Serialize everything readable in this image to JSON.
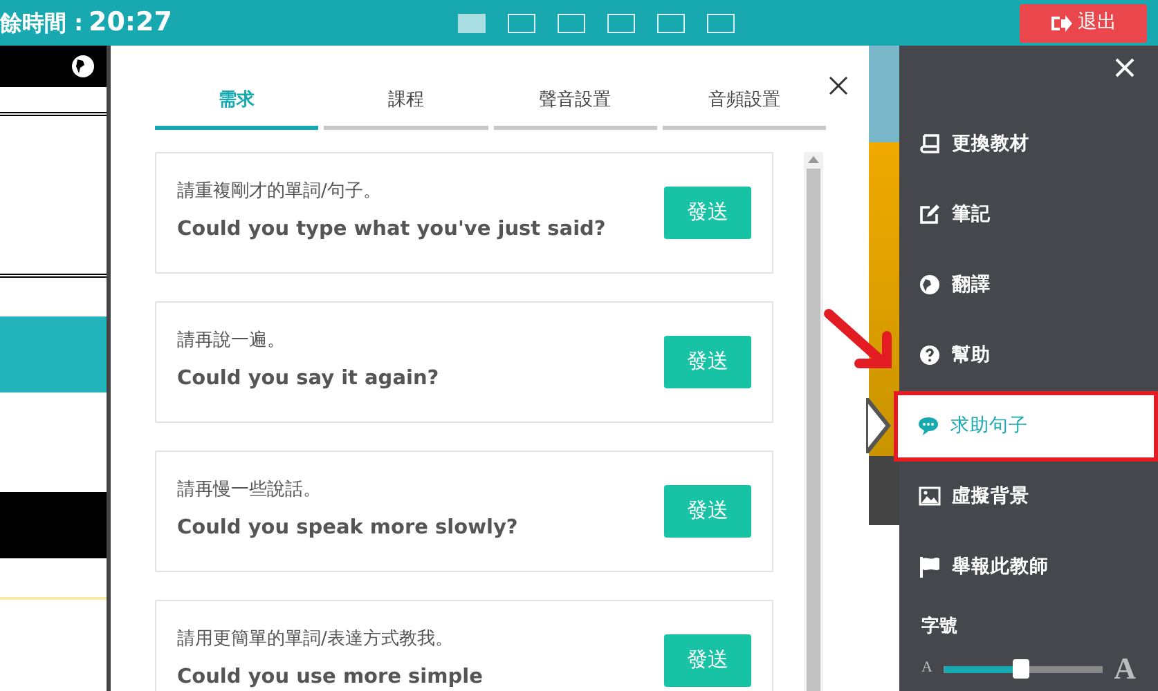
{
  "top_bar": {
    "timer_label": "餘時間 :",
    "timer_value": "20:27",
    "layouts": [
      {
        "selected": true
      },
      {
        "selected": false
      },
      {
        "selected": false
      },
      {
        "selected": false
      },
      {
        "selected": false
      },
      {
        "selected": false
      }
    ],
    "exit_button": "退出"
  },
  "dialog": {
    "tabs": [
      {
        "label": "需求",
        "selected": true
      },
      {
        "label": "課程",
        "selected": false
      },
      {
        "label": "聲音設置",
        "selected": false
      },
      {
        "label": "音頻設置",
        "selected": false
      }
    ],
    "phrases": [
      {
        "chinese": "請重複剛才的單詞/句子。",
        "english": "Could you type what you've just said?",
        "button": "發送"
      },
      {
        "chinese": "請再說一遍。",
        "english": "Could you say it again?",
        "button": "發送"
      },
      {
        "chinese": "請再慢一些說話。",
        "english": "Could you speak more slowly?",
        "button": "發送"
      },
      {
        "chinese": "請用更簡單的單詞/表達方式教我。",
        "english": "Could you use more simple",
        "button": "發送"
      }
    ]
  },
  "sidebar": {
    "items": [
      {
        "label": "更換教材",
        "kind": "book",
        "selected": false
      },
      {
        "label": "筆記",
        "kind": "edit",
        "selected": false
      },
      {
        "label": "翻譯",
        "kind": "globe",
        "selected": false
      },
      {
        "label": "幫助",
        "kind": "help",
        "selected": false
      },
      {
        "label": "求助句子",
        "kind": "chat",
        "selected": true
      },
      {
        "label": "虛擬背景",
        "kind": "image",
        "selected": false
      },
      {
        "label": "舉報此教師",
        "kind": "flag",
        "selected": false
      }
    ],
    "font_size": {
      "label": "字號",
      "small": "A",
      "large": "A",
      "level": 0.49
    }
  }
}
